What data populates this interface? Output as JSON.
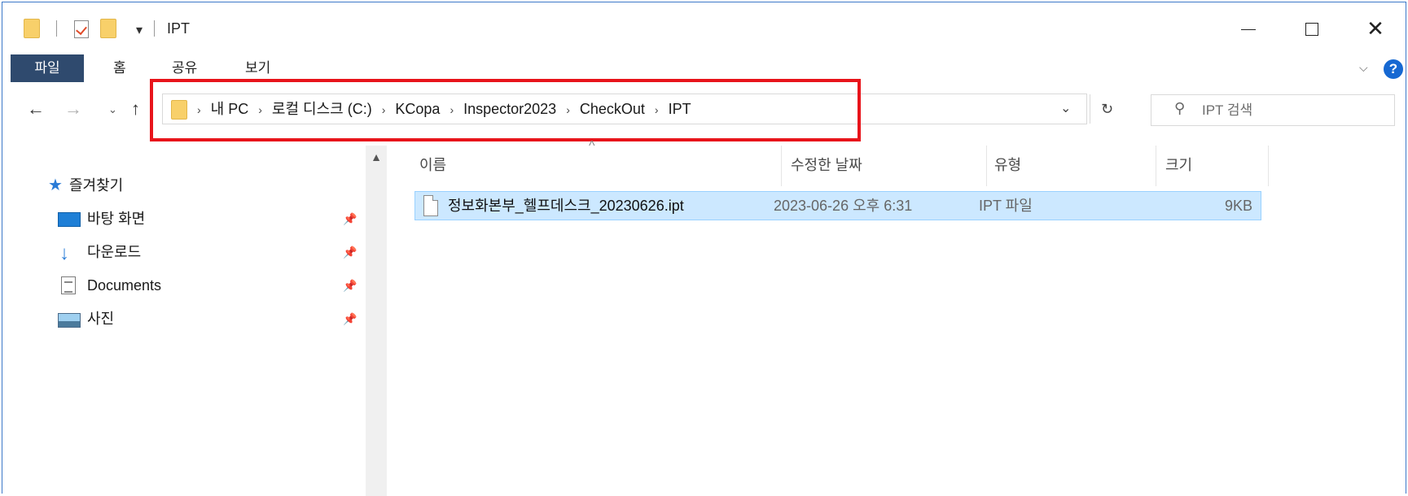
{
  "window": {
    "title": "IPT",
    "dropdown_glyph": "▾",
    "minimize": "",
    "maximize": "",
    "close": "✕"
  },
  "ribbon": {
    "tabs": [
      "파일",
      "홈",
      "공유",
      "보기"
    ],
    "expand_glyph": "⌵",
    "help_glyph": "?"
  },
  "nav": {
    "back": "←",
    "forward": "→",
    "recent": "⌄",
    "up": "↑"
  },
  "address": {
    "separator": "›",
    "crumbs": [
      "내 PC",
      "로컬 디스크 (C:)",
      "KCopa",
      "Inspector2023",
      "CheckOut",
      "IPT"
    ],
    "dropdown_glyph": "⌄",
    "refresh_glyph": "↻"
  },
  "search": {
    "placeholder": "IPT 검색",
    "icon": "⚲"
  },
  "sidebar": {
    "quick_access": "즐겨찾기",
    "items": [
      {
        "label": "바탕 화면",
        "icon": "desktop-icon"
      },
      {
        "label": "다운로드",
        "icon": "download-icon"
      },
      {
        "label": "Documents",
        "icon": "documents-icon"
      },
      {
        "label": "사진",
        "icon": "pictures-icon"
      }
    ],
    "pin_glyph": "📌"
  },
  "columns": {
    "name": "이름",
    "date": "수정한 날짜",
    "type": "유형",
    "size": "크기",
    "sort_glyph": "^"
  },
  "files": [
    {
      "name": "정보화본부_헬프데스크_20230626.ipt",
      "date": "2023-06-26 오후 6:31",
      "type": "IPT 파일",
      "size": "9KB",
      "selected": true
    }
  ],
  "colors": {
    "highlight_border": "#e8141b",
    "selection_bg": "#cce8ff",
    "accent": "#1668d2"
  }
}
